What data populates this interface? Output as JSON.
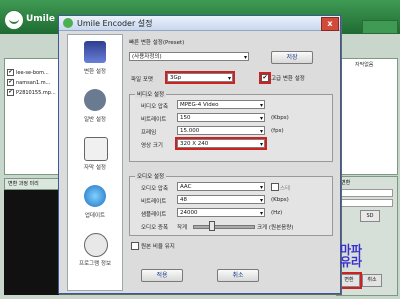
{
  "bg_app": {
    "name": "Umile",
    "files": [
      "lee-se-bom...",
      "namsan1.m...",
      "P2810155.mp..."
    ],
    "col_header": "자막없음",
    "preview_label": "변환 과정 미리",
    "right_label": "변환",
    "btn_convert": "변환",
    "btn_cancel": "취소",
    "chip": "SD"
  },
  "dialog": {
    "title": "Umile Encoder 설정",
    "close": "x",
    "nav": [
      {
        "label": "변환 설정",
        "icon": "film-icon"
      },
      {
        "label": "일반 설정",
        "icon": "settings-icon"
      },
      {
        "label": "자막 설정",
        "icon": "subtitle-icon"
      },
      {
        "label": "업데이트",
        "icon": "update-icon"
      },
      {
        "label": "프로그램 정보",
        "icon": "info-icon"
      }
    ],
    "preset": {
      "label": "빠른 변환 설정(Preset)",
      "value": "(사용자정의)",
      "save": "저장"
    },
    "file_format": {
      "label": "파일 포맷",
      "value": "3Gp"
    },
    "advanced": {
      "label": "고급 변환 설정",
      "checked": "✔"
    },
    "video": {
      "group_label": "비디오 설정",
      "codec": {
        "label": "비디오 압축",
        "value": "MPEG-4 Video"
      },
      "bitrate": {
        "label": "비트레이트",
        "value": "150",
        "unit": "(Kbps)"
      },
      "framerate": {
        "label": "프레임",
        "value": "15.000",
        "unit": "(fps)"
      },
      "size": {
        "label": "영상 크기",
        "value": "320 X 240"
      }
    },
    "audio": {
      "group_label": "오디오 설정",
      "codec": {
        "label": "오디오 압축",
        "value": "AAC",
        "stereo": "스테"
      },
      "bitrate": {
        "label": "비트레이트",
        "value": "48",
        "unit": "(Kbps)"
      },
      "samplerate": {
        "label": "샘플레이트",
        "value": "24000",
        "unit": "(Hz)"
      },
      "volume": {
        "label": "오디오 증폭",
        "low": "작게",
        "high": "크게 (원본음량)"
      }
    },
    "keep_aspect": {
      "label": "원본 비율 유지"
    },
    "ok": "적용",
    "cancel": "취소"
  },
  "watermark": {
    "line1": "마파",
    "line2": "유라"
  }
}
